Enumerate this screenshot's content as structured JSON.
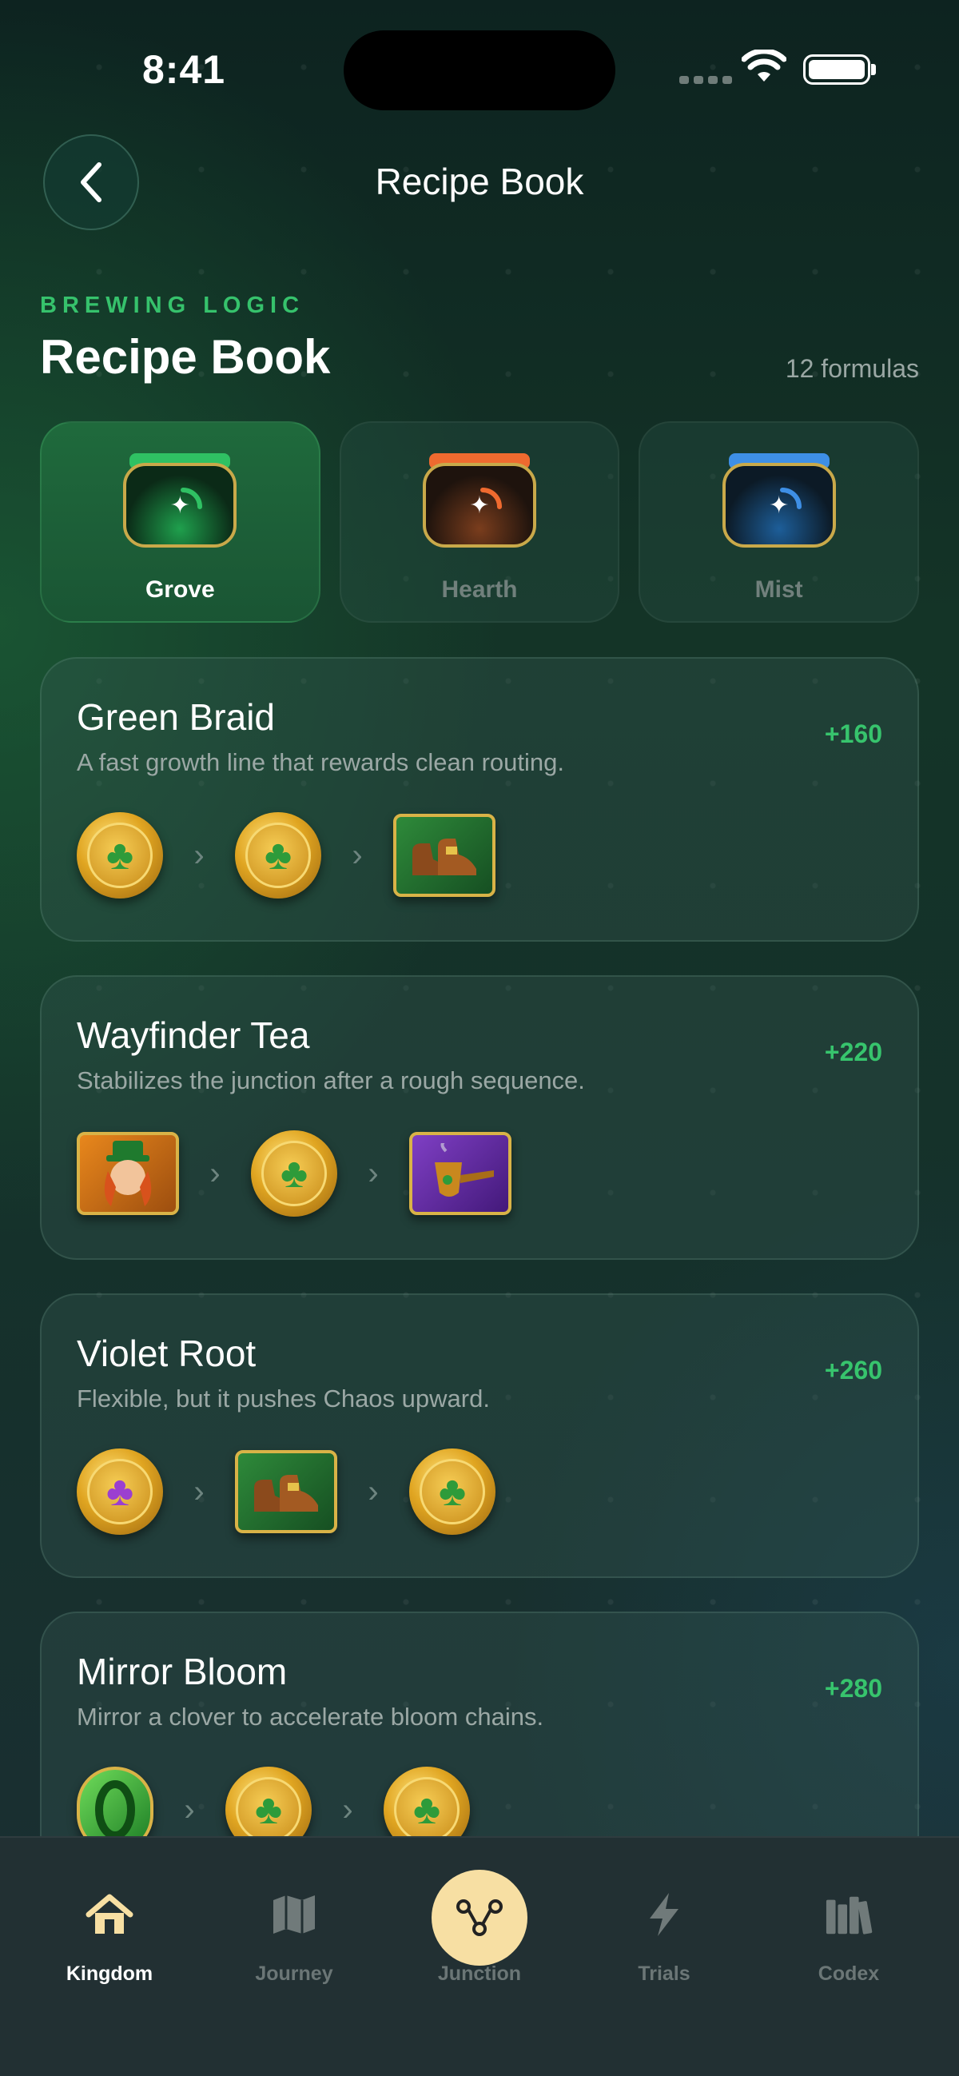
{
  "status_bar": {
    "time": "8:41"
  },
  "nav": {
    "title": "Recipe Book",
    "back_icon": "chevron-left-icon"
  },
  "header": {
    "eyebrow": "BREWING LOGIC",
    "title": "Recipe Book",
    "count": "12 formulas"
  },
  "categories": [
    {
      "label": "Grove",
      "active": true,
      "color": "#2fc163"
    },
    {
      "label": "Hearth",
      "active": false,
      "color": "#ef6a2f"
    },
    {
      "label": "Mist",
      "active": false,
      "color": "#3e8fe6"
    }
  ],
  "recipes": [
    {
      "name": "Green Braid",
      "description": "A fast growth line that rewards clean routing.",
      "points": "+160",
      "chain": [
        "gold-clover-coin",
        "gold-clover-coin",
        "boots-tile"
      ]
    },
    {
      "name": "Wayfinder Tea",
      "description": "Stabilizes the junction after a rough sequence.",
      "points": "+220",
      "chain": [
        "leprechaun-tile",
        "gold-clover-coin",
        "pipe-tile"
      ]
    },
    {
      "name": "Violet Root",
      "description": "Flexible, but it pushes Chaos upward.",
      "points": "+260",
      "chain": [
        "purple-clover-coin",
        "boots-tile",
        "gold-clover-coin"
      ]
    },
    {
      "name": "Mirror Bloom",
      "description": "Mirror a clover to accelerate bloom chains.",
      "points": "+280",
      "chain": [
        "green-zero-coin",
        "gold-clover-coin",
        "gold-clover-coin"
      ]
    }
  ],
  "tab_bar": [
    {
      "label": "Kingdom",
      "icon": "home-icon",
      "active": true
    },
    {
      "label": "Journey",
      "icon": "map-icon",
      "active": false
    },
    {
      "label": "Junction",
      "icon": "junction-icon",
      "active": false
    },
    {
      "label": "Trials",
      "icon": "lightning-icon",
      "active": false
    },
    {
      "label": "Codex",
      "icon": "books-icon",
      "active": false
    }
  ],
  "colors": {
    "accent": "#36c26c",
    "points": "#37c46d",
    "junction": "#f7dfa3"
  }
}
